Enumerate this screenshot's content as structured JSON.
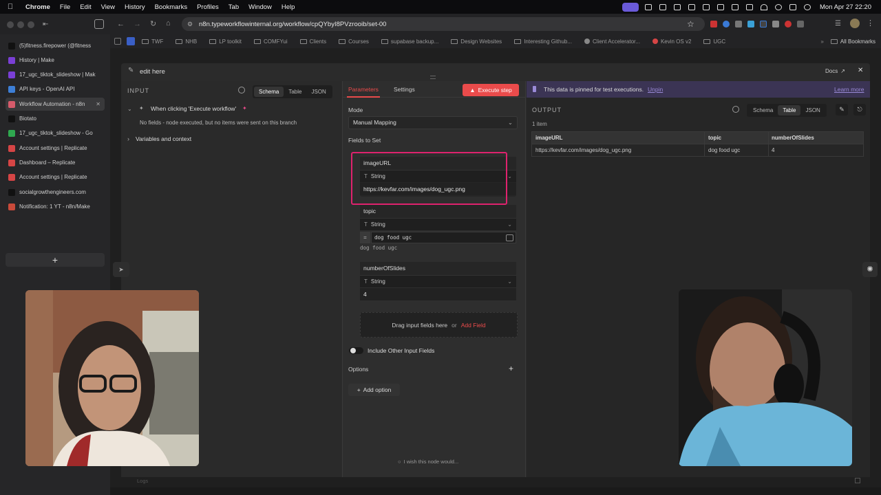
{
  "menubar": {
    "app_name": "Chrome",
    "menus": [
      "File",
      "Edit",
      "View",
      "History",
      "Bookmarks",
      "Profiles",
      "Tab",
      "Window",
      "Help"
    ],
    "clock": "Mon Apr 27  22:20"
  },
  "browser": {
    "url": "n8n.typeworkflowinternal.org/workflow/cpQYbyI8PVzrooib/set-00",
    "bookmarks": [
      "TWF",
      "NHB",
      "LP toolkit",
      "COMFYui",
      "Clients",
      "Courses",
      "supabase backup...",
      "Design Websites",
      "Interesting Github...",
      "Client Accelerator...",
      "Kevin OS v2",
      "UGC"
    ],
    "all_bookmarks": "All Bookmarks"
  },
  "sidebar": {
    "tabs": [
      {
        "label": "(5)fitness.firepower (@fitness",
        "color": "#111111"
      },
      {
        "label": "History | Make",
        "color": "#7a3fd6"
      },
      {
        "label": "17_ugc_tiktok_slideshow | Mak",
        "color": "#7a3fd6"
      },
      {
        "label": "API keys - OpenAI API",
        "color": "#3d7fd6"
      },
      {
        "label": "Workflow Automation - n8n",
        "color": "#d65b6b"
      },
      {
        "label": "Biotato",
        "color": "#111111"
      },
      {
        "label": "17_ugc_tiktok_slideshow - Go",
        "color": "#2fa84f"
      },
      {
        "label": "Account settings | Replicate",
        "color": "#d64545"
      },
      {
        "label": "Dashboard – Replicate",
        "color": "#d64545"
      },
      {
        "label": "Account settings | Replicate",
        "color": "#d64545"
      },
      {
        "label": "socialgrowthengineers.com",
        "color": "#111111"
      },
      {
        "label": "Notification: 1 YT - n8n/Make",
        "color": "#c94a3a"
      }
    ],
    "new_tab": "+"
  },
  "node": {
    "title": "edit here",
    "docs": "Docs"
  },
  "input": {
    "heading": "INPUT",
    "views": [
      "Schema",
      "Table",
      "JSON"
    ],
    "trigger": "When clicking 'Execute workflow'",
    "trigger_message": "No fields - node executed, but no items were sent on this branch",
    "variables": "Variables and context"
  },
  "params": {
    "tabs": [
      "Parameters",
      "Settings"
    ],
    "execute": "Execute step",
    "mode_label": "Mode",
    "mode_value": "Manual Mapping",
    "fields_label": "Fields to Set",
    "fields": [
      {
        "name": "imageURL",
        "type": "String",
        "value": "https://kevfar.com/images/dog_ugc.png"
      },
      {
        "name": "topic",
        "type": "String",
        "value": "dog food ugc",
        "preview": "dog food ugc"
      },
      {
        "name": "numberOfSlides",
        "type": "String",
        "value": "4"
      }
    ],
    "drag_text": "Drag input fields here",
    "or": "or",
    "add_field": "Add Field",
    "include_other": "Include Other Input Fields",
    "options_label": "Options",
    "add_option": "Add option",
    "wish": "I wish this node would..."
  },
  "output": {
    "pinned_message": "This data is pinned for test executions.",
    "unpin": "Unpin",
    "learn_more": "Learn more",
    "heading": "OUTPUT",
    "views": [
      "Schema",
      "Table",
      "JSON"
    ],
    "count": "1 item",
    "columns": [
      "imageURL",
      "topic",
      "numberOfSlides"
    ],
    "rows": [
      [
        "https://kevfar.com/images/dog_ugc.png",
        "dog food ugc",
        "4"
      ]
    ]
  },
  "footer": {
    "logs": "Logs"
  },
  "colors": {
    "accent": "#ea4b4b",
    "pinned_bg": "#3b3454",
    "highlight": "#e0226e"
  }
}
